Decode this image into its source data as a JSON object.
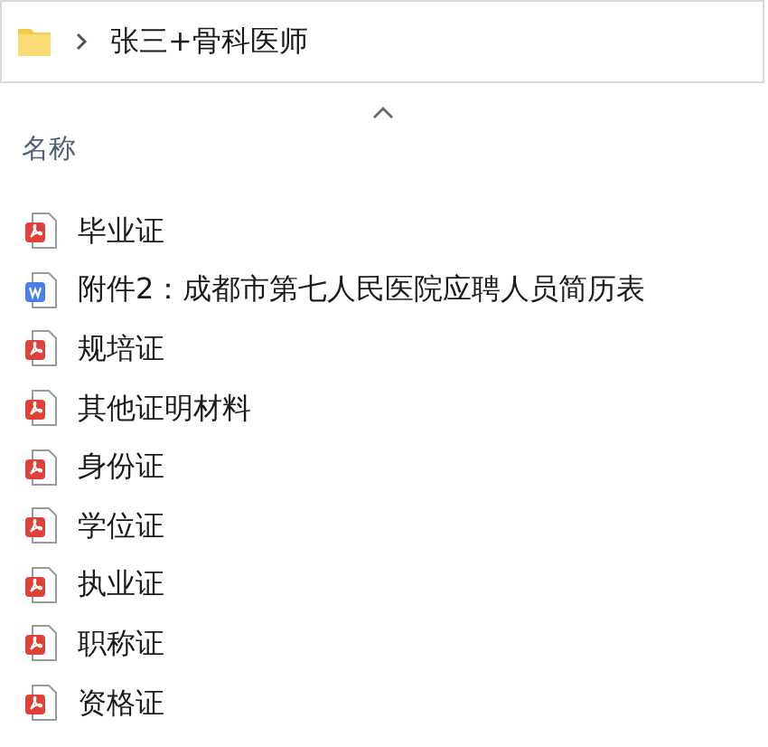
{
  "address_bar": {
    "path": "张三+骨科医师"
  },
  "column_header": {
    "label": "名称",
    "sorted_ascending": true
  },
  "files": [
    {
      "name": "毕业证",
      "kind": "pdf"
    },
    {
      "name": "附件2：成都市第七人民医院应聘人员简历表",
      "kind": "word"
    },
    {
      "name": "规培证",
      "kind": "pdf"
    },
    {
      "name": "其他证明材料",
      "kind": "pdf"
    },
    {
      "name": "身份证",
      "kind": "pdf"
    },
    {
      "name": "学位证",
      "kind": "pdf"
    },
    {
      "name": "执业证",
      "kind": "pdf"
    },
    {
      "name": "职称证",
      "kind": "pdf"
    },
    {
      "name": "资格证",
      "kind": "pdf"
    }
  ]
}
